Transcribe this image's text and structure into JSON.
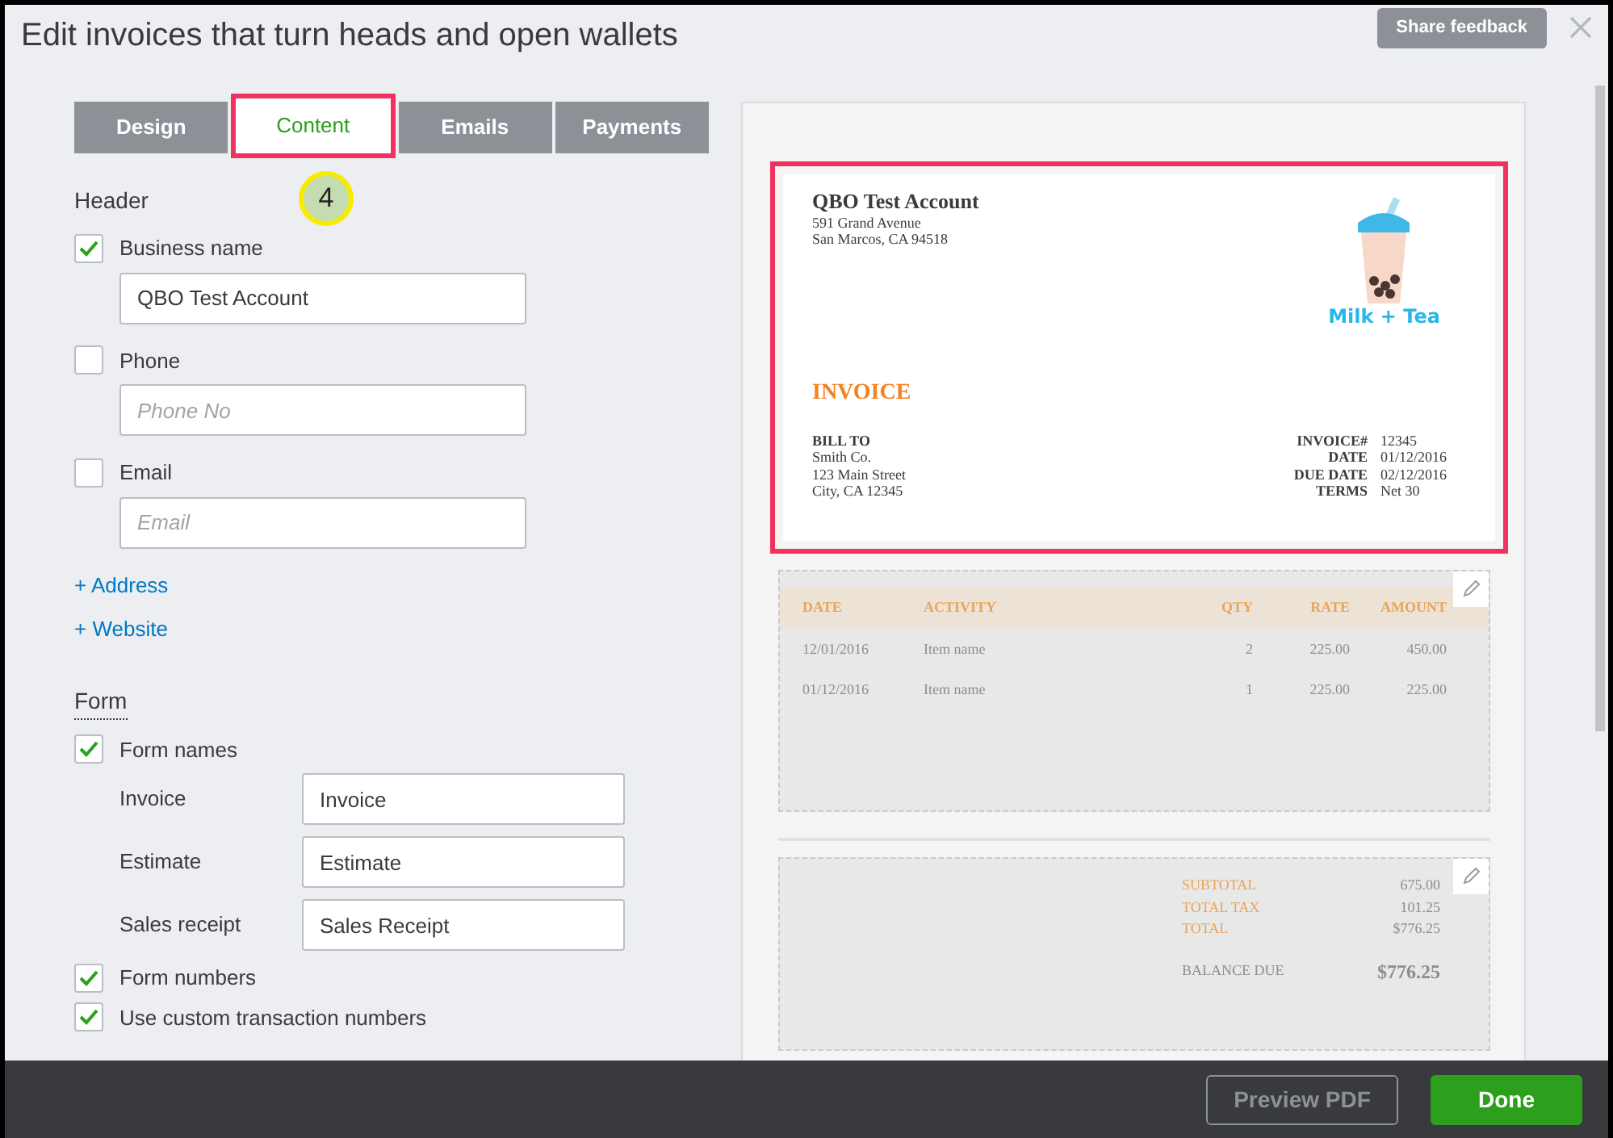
{
  "window": {
    "title": "Edit invoices that turn heads and open wallets"
  },
  "share_feedback": "Share feedback",
  "tabs": [
    {
      "label": "Design",
      "selected": false,
      "highlighted": false
    },
    {
      "label": "Content",
      "selected": true,
      "highlighted": true
    },
    {
      "label": "Emails",
      "selected": false,
      "highlighted": false
    },
    {
      "label": "Payments",
      "selected": false,
      "highlighted": false
    }
  ],
  "step_marker": "4",
  "sections": [
    {
      "heading": "Header",
      "underlined": false,
      "items": [
        {
          "kind": "check",
          "label": "Business name",
          "checked": true
        },
        {
          "kind": "field",
          "value": "QBO Test Account"
        },
        {
          "kind": "check",
          "label": "Phone",
          "checked": false
        },
        {
          "kind": "field",
          "placeholder": "Phone No"
        },
        {
          "kind": "check",
          "label": "Email",
          "checked": false
        },
        {
          "kind": "field",
          "placeholder": "Email"
        },
        {
          "kind": "link",
          "label": "+ Address"
        },
        {
          "kind": "link",
          "label": "+ Website"
        }
      ]
    },
    {
      "heading": "Form",
      "underlined": true,
      "items": [
        {
          "kind": "check",
          "label": "Form names",
          "checked": true
        },
        {
          "kind": "labeled_field",
          "label": "Invoice",
          "value": "Invoice"
        },
        {
          "kind": "labeled_field",
          "label": "Estimate",
          "value": "Estimate"
        },
        {
          "kind": "labeled_field",
          "label": "Sales receipt",
          "value": "Sales Receipt"
        },
        {
          "kind": "check",
          "label": "Form numbers",
          "checked": true
        },
        {
          "kind": "check",
          "label": "Use custom transaction numbers",
          "checked": true
        }
      ]
    }
  ],
  "preview": {
    "highlighted": true,
    "business_name": "QBO Test Account",
    "address": [
      "591 Grand Avenue",
      "San Marcos, CA 94518"
    ],
    "logo_text": "Milk + Tea",
    "invoice_title": "INVOICE",
    "bill_to": {
      "heading": "BILL TO",
      "lines": [
        "Smith Co.",
        "123 Main Street",
        "City, CA 12345"
      ]
    },
    "meta": [
      {
        "label": "INVOICE#",
        "value": "12345"
      },
      {
        "label": "DATE",
        "value": "01/12/2016"
      },
      {
        "label": "DUE DATE",
        "value": "02/12/2016"
      },
      {
        "label": "TERMS",
        "value": "Net 30"
      }
    ],
    "table": {
      "columns": [
        "DATE",
        "ACTIVITY",
        "QTY",
        "RATE",
        "AMOUNT"
      ],
      "rows": [
        [
          "12/01/2016",
          "Item name",
          "2",
          "225.00",
          "450.00"
        ],
        [
          "01/12/2016",
          "Item name",
          "1",
          "225.00",
          "225.00"
        ]
      ]
    },
    "totals": [
      {
        "label": "SUBTOTAL",
        "value": "675.00"
      },
      {
        "label": "TOTAL TAX",
        "value": "101.25"
      },
      {
        "label": "TOTAL",
        "value": "$776.25"
      }
    ],
    "balance_due": {
      "label": "BALANCE DUE",
      "value": "$776.25"
    }
  },
  "footer": {
    "buttons": [
      {
        "label": "Preview PDF",
        "kind": "secondary"
      },
      {
        "label": "Done",
        "kind": "primary"
      }
    ]
  }
}
